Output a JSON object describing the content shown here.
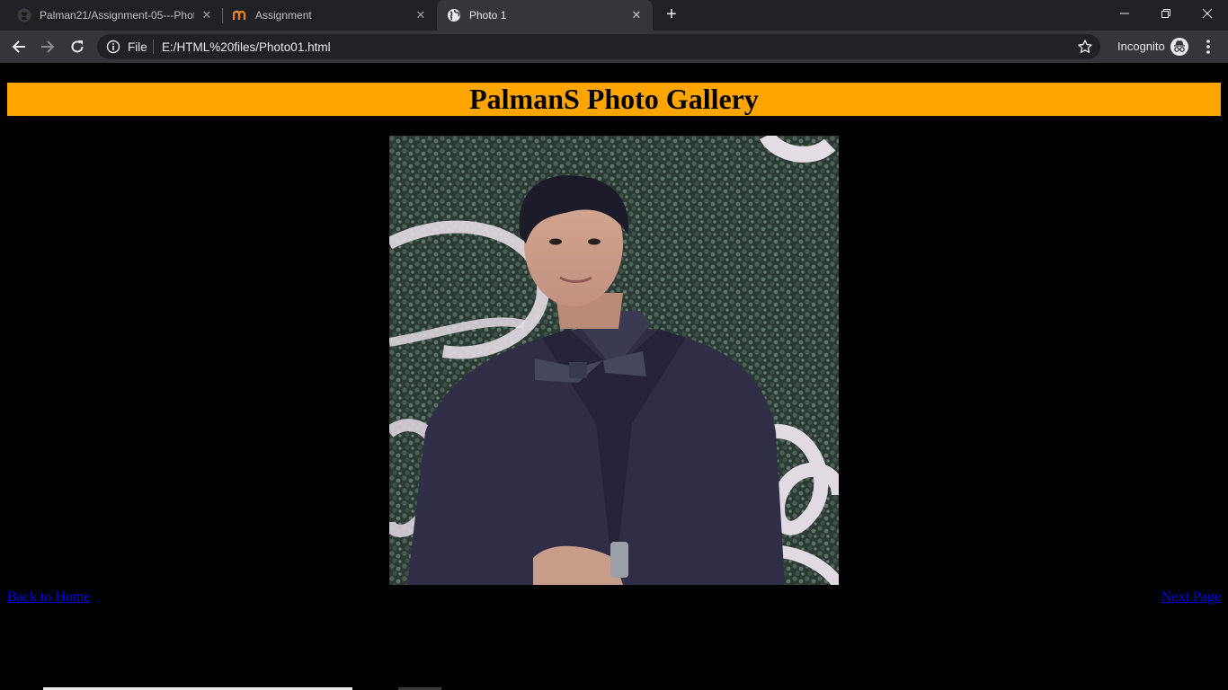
{
  "browser": {
    "tabs": [
      {
        "title": "Palman21/Assignment-05---Phot",
        "icon": "github-icon",
        "active": false
      },
      {
        "title": "Assignment",
        "icon": "moodle-icon",
        "active": false
      },
      {
        "title": "Photo 1",
        "icon": "globe-icon",
        "active": true
      }
    ],
    "address": {
      "scheme_label": "File",
      "url": "E:/HTML%20files/Photo01.html"
    },
    "profile_label": "Incognito",
    "colors": {
      "frame": "#202124",
      "toolbar": "#35363a",
      "omnibox": "#202124",
      "text": "#e8eaed"
    }
  },
  "page": {
    "title": "PalmanS Photo Gallery",
    "header_color": "#ffa500",
    "background": "#000000",
    "photo_alt": "Photo 1",
    "links": {
      "back": "Back to Home",
      "next": "Next Page"
    }
  }
}
